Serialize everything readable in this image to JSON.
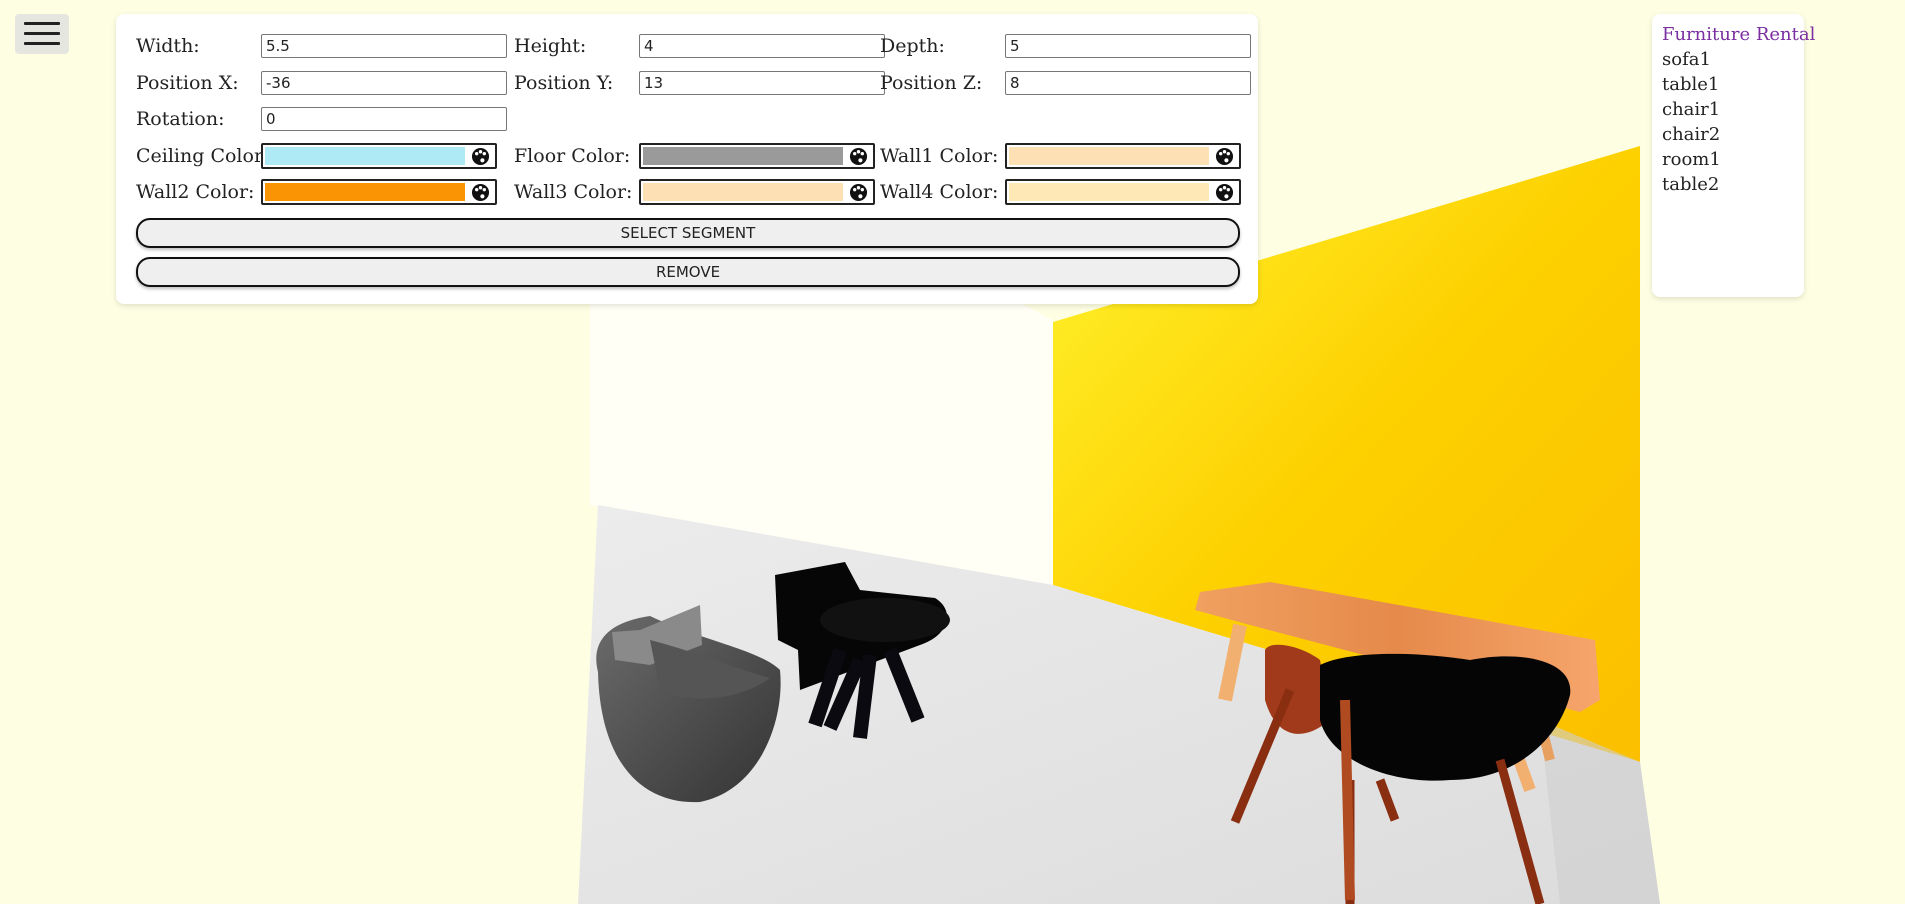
{
  "menu": {
    "icon": "hamburger-icon"
  },
  "settings": {
    "width": {
      "label": "Width:",
      "value": "5.5"
    },
    "height": {
      "label": "Height:",
      "value": "4"
    },
    "depth": {
      "label": "Depth:",
      "value": "5"
    },
    "position_x": {
      "label": "Position X:",
      "value": "-36"
    },
    "position_y": {
      "label": "Position Y:",
      "value": "13"
    },
    "position_z": {
      "label": "Position Z:",
      "value": "8"
    },
    "rotation": {
      "label": "Rotation:",
      "value": "0"
    },
    "ceiling_color": {
      "label": "Ceiling Color:",
      "color": "#aeeaf6",
      "icon": "palette-icon"
    },
    "floor_color": {
      "label": "Floor Color:",
      "color": "#9a9a9a",
      "icon": "palette-icon"
    },
    "wall1_color": {
      "label": "Wall1 Color:",
      "color": "#fde0b4",
      "icon": "palette-icon"
    },
    "wall2_color": {
      "label": "Wall2 Color:",
      "color": "#fb9404",
      "icon": "palette-icon"
    },
    "wall3_color": {
      "label": "Wall3 Color:",
      "color": "#fde0b4",
      "icon": "palette-icon"
    },
    "wall4_color": {
      "label": "Wall4 Color:",
      "color": "#fde8b6",
      "icon": "palette-icon"
    },
    "select_segment_label": "SELECT SEGMENT",
    "remove_label": "REMOVE"
  },
  "furniture_list": {
    "title": "Furniture Rental",
    "items": [
      "sofa1",
      "table1",
      "chair1",
      "chair2",
      "room1",
      "table2"
    ]
  },
  "colors": {
    "background": "#fefee3",
    "yellow_wall": "#fdd000",
    "floor": "#e8e8e8",
    "title": "#7a2ea0"
  }
}
